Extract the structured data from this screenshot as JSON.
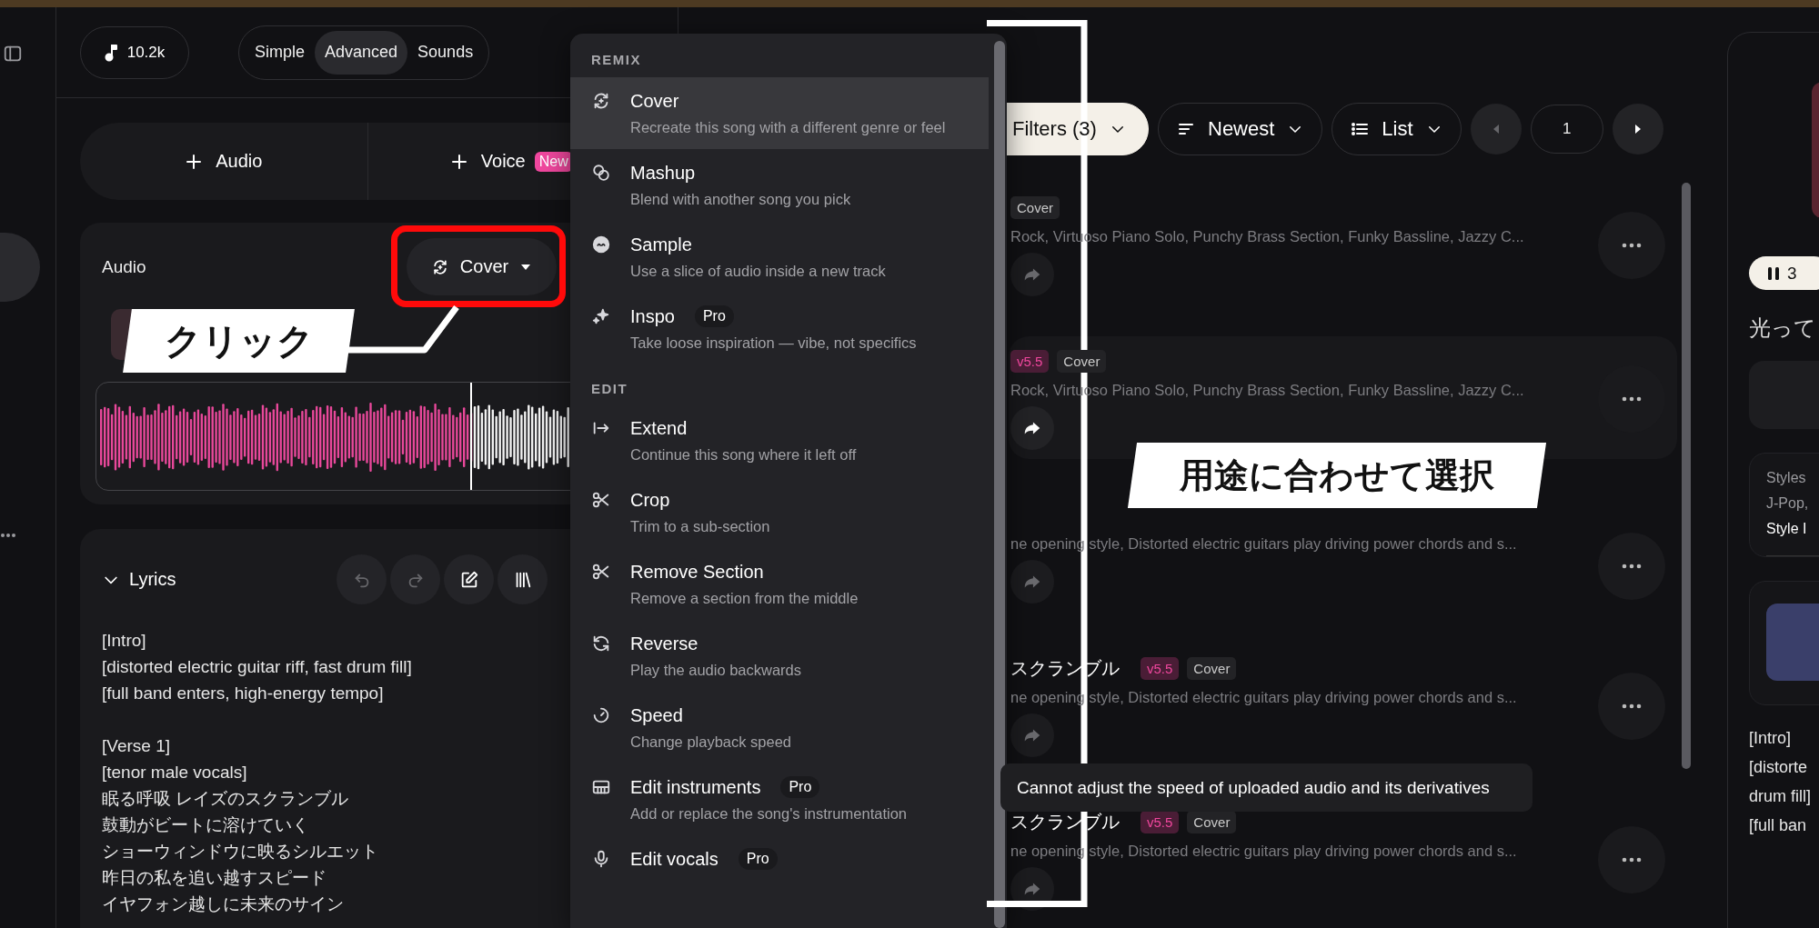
{
  "header": {
    "credits": "10.2k",
    "modes": [
      {
        "label": "Simple",
        "selected": false
      },
      {
        "label": "Advanced",
        "selected": true
      },
      {
        "label": "Sounds",
        "selected": false
      }
    ]
  },
  "add_buttons": [
    {
      "label": "Audio"
    },
    {
      "label": "Voice",
      "badge": "New"
    }
  ],
  "audio": {
    "title": "Audio",
    "mode_button": "Cover",
    "waveform": {
      "level": 0.69
    }
  },
  "lyrics": {
    "title": "Lyrics",
    "expanded": true,
    "tools": [
      {
        "kind": "undo",
        "disabled": true
      },
      {
        "kind": "redo",
        "disabled": true
      },
      {
        "kind": "edit",
        "disabled": false
      },
      {
        "kind": "library",
        "disabled": false
      }
    ],
    "stanzas": [
      [
        "[Intro]",
        "[distorted electric guitar riff, fast drum fill]",
        "[full band enters, high-energy tempo]"
      ],
      [
        "[Verse 1]",
        "[tenor male vocals]",
        "眠る呼吸 レイズのスクランブル",
        "鼓動がビートに溶けていく",
        "ショーウィンドウに映るシルエット",
        "昨日の私を追い越すスピード",
        "イヤフォン越しに未来のサイン"
      ]
    ]
  },
  "menu": {
    "sections": [
      {
        "heading": "REMIX",
        "items": [
          {
            "kind": "cover",
            "label": "Cover",
            "description": "Recreate this song with a different genre or feel",
            "selected": true
          },
          {
            "kind": "mashup",
            "label": "Mashup",
            "description": "Blend with another song you pick",
            "selected": false
          },
          {
            "kind": "sample",
            "label": "Sample",
            "description": "Use a slice of audio inside a new track",
            "selected": false
          },
          {
            "kind": "inspo",
            "label": "Inspo",
            "badge": "Pro",
            "description": "Take loose inspiration — vibe, not specifics",
            "selected": false
          }
        ]
      },
      {
        "heading": "EDIT",
        "items": [
          {
            "kind": "extend",
            "label": "Extend",
            "description": "Continue this song where it left off",
            "selected": false
          },
          {
            "kind": "scissors",
            "label": "Crop",
            "description": "Trim to a sub-section",
            "selected": false
          },
          {
            "kind": "scissors",
            "label": "Remove Section",
            "description": "Remove a section from the middle",
            "selected": false
          },
          {
            "kind": "reverse",
            "label": "Reverse",
            "description": "Play the audio backwards",
            "selected": false
          },
          {
            "kind": "speed",
            "label": "Speed",
            "description": "Change playback speed",
            "selected": false
          },
          {
            "kind": "piano",
            "label": "Edit instruments",
            "badge": "Pro",
            "description": "Add or replace the song's instrumentation",
            "selected": false
          },
          {
            "kind": "mic",
            "label": "Edit vocals",
            "badge": "Pro",
            "selected": false
          }
        ]
      }
    ]
  },
  "toolbar": {
    "filters": "Filters (3)",
    "sort": "Newest",
    "view": "List",
    "page": "1"
  },
  "songs": [
    {
      "tags": [
        {
          "text": "Cover",
          "kind": "type"
        }
      ],
      "description": "Rock, Virtuoso Piano Solo, Punchy Brass Section, Funky Bassline, Jazzy C...",
      "highlighted": false
    },
    {
      "tags": [
        {
          "text": "v5.5",
          "kind": "version"
        },
        {
          "text": "Cover",
          "kind": "type"
        }
      ],
      "description": "Rock, Virtuoso Piano Solo, Punchy Brass Section, Funky Bassline, Jazzy C...",
      "highlighted": true
    },
    {
      "description": "ne opening style, Distorted electric guitars play driving power chords and s...",
      "highlighted": false
    },
    {
      "title": "スクランブル",
      "tags": [
        {
          "text": "v5.5",
          "kind": "version"
        },
        {
          "text": "Cover",
          "kind": "type"
        }
      ],
      "description": "ne opening style, Distorted electric guitars play driving power chords and s...",
      "highlighted": false
    },
    {
      "title": "スクランブル",
      "tags": [
        {
          "text": "v5.5",
          "kind": "version"
        },
        {
          "text": "Cover",
          "kind": "type"
        }
      ],
      "description": "ne opening style, Distorted electric guitars play driving power chords and s...",
      "highlighted": false
    }
  ],
  "tooltip": "Cannot adjust the speed of uploaded audio and its derivatives",
  "now_playing": {
    "count": "3",
    "title": "光って",
    "styles_label": "Styles",
    "styles": "J-Pop,",
    "style_influence": "Style I",
    "lyrics": [
      "[Intro]",
      "[distorte",
      "drum fill]",
      "[full ban"
    ]
  },
  "callouts": [
    {
      "kind": "click",
      "text": "クリック"
    },
    {
      "kind": "choose",
      "text": "用途に合わせて選択"
    }
  ]
}
